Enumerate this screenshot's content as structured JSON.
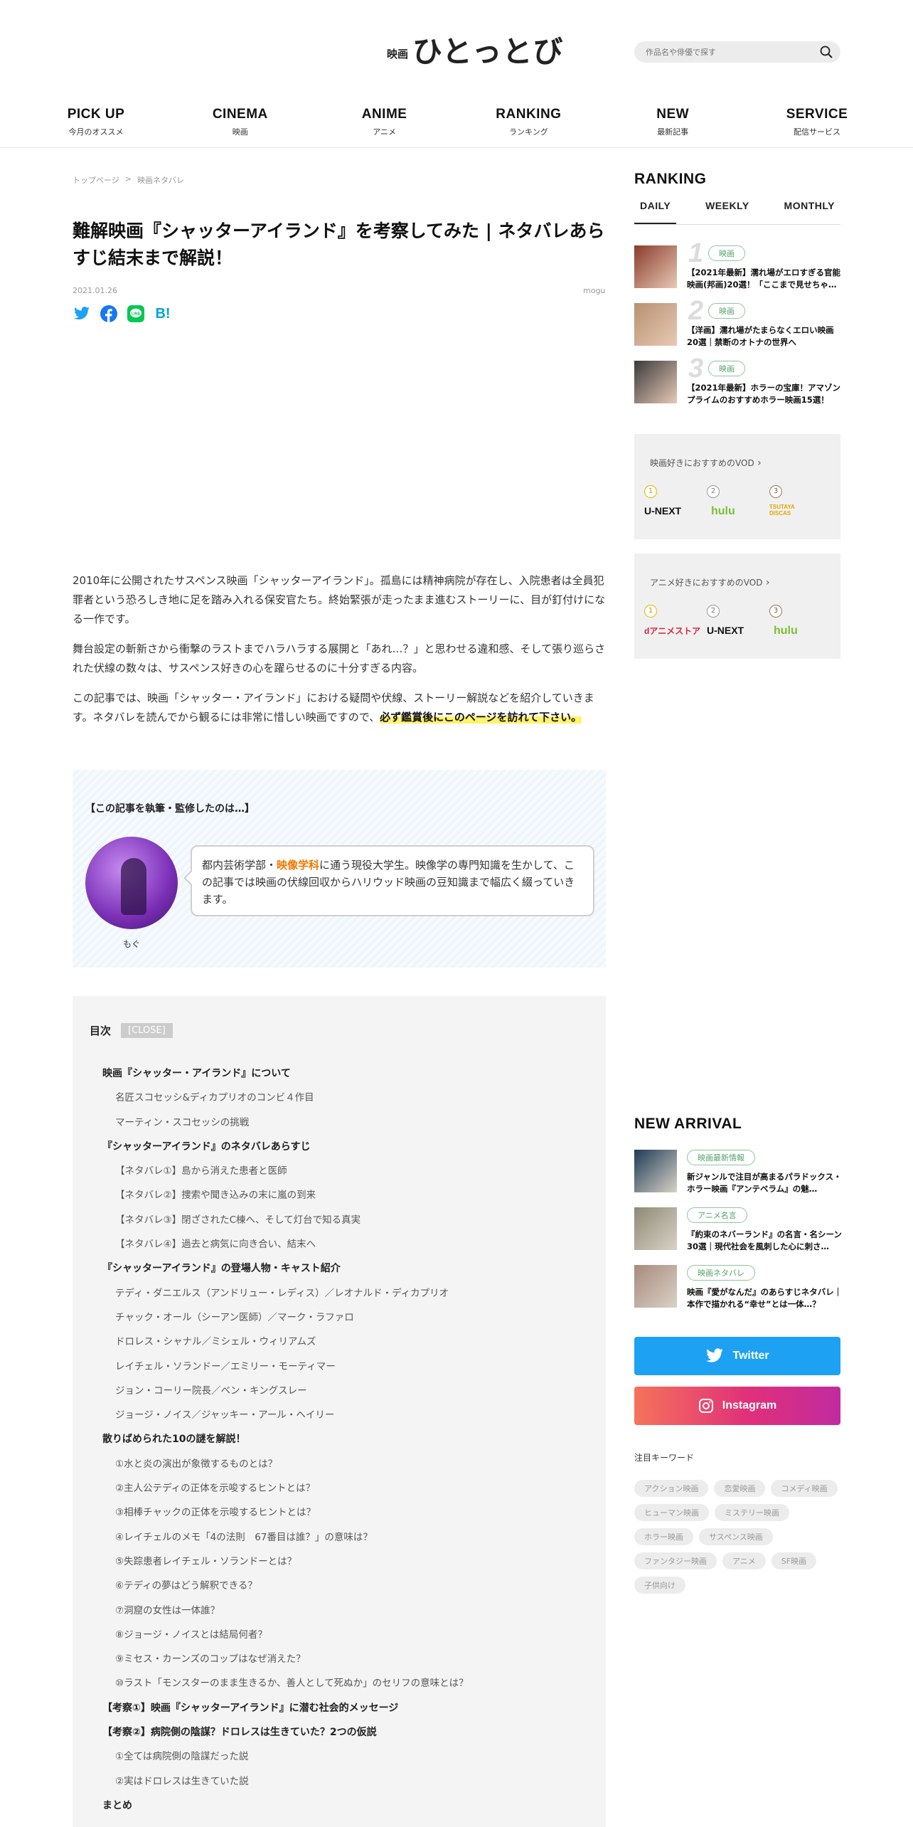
{
  "header": {
    "logo_small": "映画",
    "logo_big": "ひとっとび",
    "search_placeholder": "作品名や俳優で探す",
    "nav": [
      {
        "en": "PICK UP",
        "ja": "今月のオススメ"
      },
      {
        "en": "CINEMA",
        "ja": "映画"
      },
      {
        "en": "ANIME",
        "ja": "アニメ"
      },
      {
        "en": "RANKING",
        "ja": "ランキング"
      },
      {
        "en": "NEW",
        "ja": "最新記事"
      },
      {
        "en": "SERVICE",
        "ja": "配信サービス"
      }
    ]
  },
  "breadcrumb": {
    "home": "トップページ",
    "sep": ">",
    "current": "映画ネタバレ"
  },
  "article": {
    "title": "難解映画『シャッターアイランド』を考察してみた | ネタバレあらすじ結末まで解説！",
    "date": "2021.01.26",
    "author": "mogu",
    "share": {
      "hatena": "B!"
    },
    "p1": "2010年に公開されたサスペンス映画「シャッターアイランド」。孤島には精神病院が存在し、入院患者は全員犯罪者という恐ろしき地に足を踏み入れる保安官たち。終始緊張が走ったまま進むストーリーに、目が釘付けになる一作です。",
    "p2": "舞台設定の斬新さから衝撃のラストまでハラハラする展開と「あれ…？」と思わせる違和感、そして張り巡らされた伏線の数々は、サスペンス好きの心を躍らせるのに十分すぎる内容。",
    "p3_plain": "この記事では、映画「シャッター・アイランド」における疑問や伏線、ストーリー解説などを紹介していきます。ネタバレを読んでから観るには非常に惜しい映画ですので、",
    "p3_highlight": "必ず鑑賞後にこのページを訪れて下さい。"
  },
  "author_box": {
    "heading": "【この記事を執筆・監修したのは…】",
    "name": "もぐ",
    "bio_before": "都内芸術学部・",
    "bio_highlight": "映像学科",
    "bio_after": "に通う現役大学生。映像学の専門知識を生かして、この記事では映画の伏線回収からハリウッド映画の豆知識まで幅広く綴っていきます。"
  },
  "toc": {
    "label": "目次",
    "close": "[CLOSE]",
    "items": [
      {
        "level": 2,
        "text": "映画『シャッター・アイランド』について"
      },
      {
        "level": 3,
        "text": "名匠スコセッシ&ディカプリオのコンビ４作目"
      },
      {
        "level": 3,
        "text": "マーティン・スコセッシの挑戦"
      },
      {
        "level": 2,
        "text": "『シャッターアイランド』のネタバレあらすじ"
      },
      {
        "level": 3,
        "text": "【ネタバレ①】島から消えた患者と医師"
      },
      {
        "level": 3,
        "text": "【ネタバレ②】捜索や聞き込みの末に嵐の到来"
      },
      {
        "level": 3,
        "text": "【ネタバレ③】閉ざされたC棟へ、そして灯台で知る真実"
      },
      {
        "level": 3,
        "text": "【ネタバレ④】過去と病気に向き合い、結末へ"
      },
      {
        "level": 2,
        "text": "『シャッターアイランド』の登場人物・キャスト紹介"
      },
      {
        "level": 3,
        "text": "テディ・ダニエルス（アンドリュー・レディス）／レオナルド・ディカプリオ"
      },
      {
        "level": 3,
        "text": "チャック・オール（シーアン医師）／マーク・ラファロ"
      },
      {
        "level": 3,
        "text": "ドロレス・シャナル／ミシェル・ウィリアムズ"
      },
      {
        "level": 3,
        "text": "レイチェル・ソランドー／エミリー・モーティマー"
      },
      {
        "level": 3,
        "text": "ジョン・コーリー院長／ベン・キングスレー"
      },
      {
        "level": 3,
        "text": "ジョージ・ノイス／ジャッキー・アール・ヘイリー"
      },
      {
        "level": 2,
        "text": "散りばめられた10の謎を解説！"
      },
      {
        "level": 3,
        "text": "①水と炎の演出が象徴するものとは？"
      },
      {
        "level": 3,
        "text": "②主人公テディの正体を示唆するヒントとは？"
      },
      {
        "level": 3,
        "text": "③相棒チャックの正体を示唆するヒントとは？"
      },
      {
        "level": 3,
        "text": "④レイチェルのメモ「4の法則　67番目は誰？」の意味は？"
      },
      {
        "level": 3,
        "text": "⑤失踪患者レイチェル・ソランドーとは？"
      },
      {
        "level": 3,
        "text": "⑥テディの夢はどう解釈できる？"
      },
      {
        "level": 3,
        "text": "⑦洞窟の女性は一体誰？"
      },
      {
        "level": 3,
        "text": "⑧ジョージ・ノイスとは結局何者？"
      },
      {
        "level": 3,
        "text": "⑨ミセス・カーンズのコップはなぜ消えた？"
      },
      {
        "level": 3,
        "text": "⑩ラスト「モンスターのまま生きるか、善人として死ぬか」のセリフの意味とは？"
      },
      {
        "level": 2,
        "text": "【考察①】映画『シャッターアイランド』に潜む社会的メッセージ"
      },
      {
        "level": 2,
        "text": "【考察②】病院側の陰謀？ドロレスは生きていた？2つの仮説"
      },
      {
        "level": 3,
        "text": "①全ては病院側の陰謀だった説"
      },
      {
        "level": 3,
        "text": "②実はドロレスは生きていた説"
      },
      {
        "level": 2,
        "text": "まとめ"
      }
    ]
  },
  "sidebar": {
    "ranking_title": "RANKING",
    "tabs": [
      "DAILY",
      "WEEKLY",
      "MONTHLY"
    ],
    "ranking": [
      {
        "num": "1",
        "tag": "映画",
        "title": "【2021年最新】濡れ場がエロすぎる官能映画(邦画)20選！「ここまで見せちゃ…",
        "color": "#8a3b2c"
      },
      {
        "num": "2",
        "tag": "映画",
        "title": "【洋画】濡れ場がたまらなくエロい映画20選｜禁断のオトナの世界へ",
        "color": "#b89070"
      },
      {
        "num": "3",
        "tag": "映画",
        "title": "【2021年最新】ホラーの宝庫！アマゾンプライムのおすすめホラー映画15選！",
        "color": "#3a3a3a"
      }
    ],
    "vod_movie": {
      "title": "映画好きにおすすめのVOD",
      "items": [
        {
          "rank": "1",
          "name": "U-NEXT",
          "color": "#111111"
        },
        {
          "rank": "2",
          "name": "hulu",
          "color": "#7bbf34"
        },
        {
          "rank": "3",
          "name": "TSUTAYA DISCAS",
          "color": "#e0a800"
        }
      ]
    },
    "vod_anime": {
      "title": "アニメ好きにおすすめのVOD",
      "items": [
        {
          "rank": "1",
          "name": "dアニメストア",
          "color": "#d7263d"
        },
        {
          "rank": "2",
          "name": "U-NEXT",
          "color": "#111111"
        },
        {
          "rank": "3",
          "name": "hulu",
          "color": "#7bbf34"
        }
      ]
    },
    "new_arrival_title": "NEW ARRIVAL",
    "new_arrivals": [
      {
        "tag": "映画最新情報",
        "title": "新ジャンルで注目が高まるパラドックス・ホラー映画『アンテベラム』の魅…",
        "color": "#1d3b55"
      },
      {
        "tag": "アニメ名言",
        "title": "『約束のネバーランド』の名言・名シーン30選｜現代社会を風刺した心に刺さ…",
        "color": "#8d8a74"
      },
      {
        "tag": "映画ネタバレ",
        "title": "映画『愛がなんだ』のあらすじネタバレ｜本作で描かれる“幸せ”とは一体…？",
        "color": "#a88a7c"
      }
    ],
    "twitter": "Twitter",
    "instagram": "Instagram",
    "keywords_title": "注目キーワード",
    "keywords": [
      "アクション映画",
      "恋愛映画",
      "コメディ映画",
      "ヒューマン映画",
      "ミステリー映画",
      "ホラー映画",
      "サスペンス映画",
      "ファンタジー映画",
      "アニメ",
      "SF映画",
      "子供向け"
    ]
  },
  "colors": {
    "accent_green": "#55a36b",
    "highlight": "#fff36b",
    "twitter": "#1da1f2",
    "link_orange": "#f07800"
  }
}
